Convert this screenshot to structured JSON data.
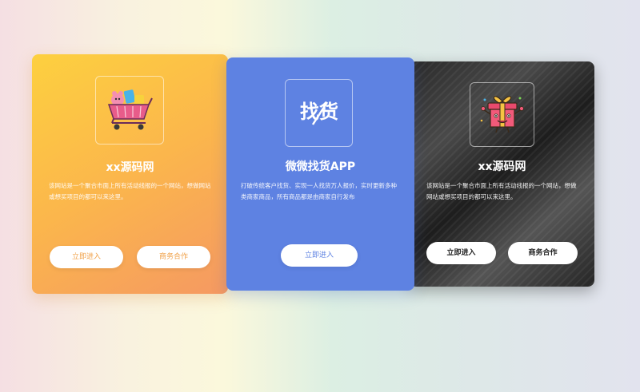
{
  "cards": [
    {
      "icon": "shopping-cart-icon",
      "title": "xx源码网",
      "description": "该网站是一个聚合市面上所有活动线报的一个网站，想做网站或想买项目的都可以来这里。",
      "enter_label": "立即进入",
      "biz_label": "商务合作",
      "accent": "#f0a24a"
    },
    {
      "icon": "zhaohuo-logo-icon",
      "logo_text": "找货",
      "title": "微微找货APP",
      "description": "打破传统客户找货、实现一人找货万人报价，实时更新多种类商家商品，所有商品都是由商家自行发布",
      "enter_label": "立即进入",
      "accent": "#5e82e2"
    },
    {
      "icon": "gift-box-icon",
      "title": "xx源码网",
      "description": "该网站是一个聚合市面上所有活动线报的一个网站，想做网站或想买项目的都可以来这里。",
      "enter_label": "立即进入",
      "biz_label": "商务合作",
      "accent": "#222222"
    }
  ]
}
